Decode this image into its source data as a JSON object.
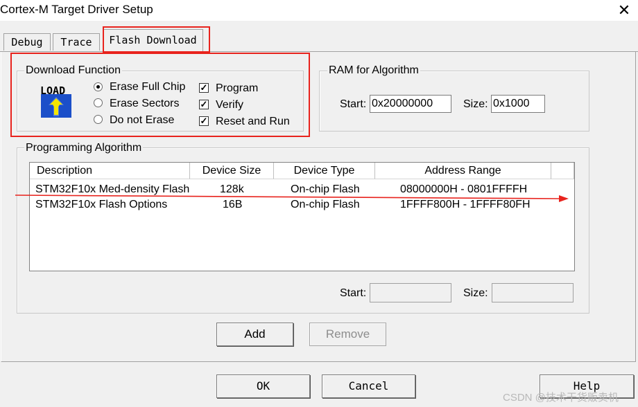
{
  "window": {
    "title": "Cortex-M Target Driver Setup",
    "close_glyph": "✕"
  },
  "tabs": [
    {
      "label": "Debug",
      "active": false
    },
    {
      "label": "Trace",
      "active": false
    },
    {
      "label": "Flash Download",
      "active": true
    }
  ],
  "download_function": {
    "legend": "Download Function",
    "logo_text": "LOAD",
    "radios": [
      {
        "label": "Erase Full Chip",
        "selected": true
      },
      {
        "label": "Erase Sectors",
        "selected": false
      },
      {
        "label": "Do not Erase",
        "selected": false
      }
    ],
    "checks": [
      {
        "label": "Program",
        "checked": true
      },
      {
        "label": "Verify",
        "checked": true
      },
      {
        "label": "Reset and Run",
        "checked": true
      }
    ],
    "check_glyph": "✓"
  },
  "ram": {
    "legend": "RAM for Algorithm",
    "start_label": "Start:",
    "start_value": "0x20000000",
    "size_label": "Size:",
    "size_value": "0x1000"
  },
  "programming": {
    "legend": "Programming Algorithm",
    "columns": [
      "Description",
      "Device Size",
      "Device Type",
      "Address Range"
    ],
    "rows": [
      [
        "STM32F10x Med-density Flash",
        "128k",
        "On-chip Flash",
        "08000000H - 0801FFFFH"
      ],
      [
        "STM32F10x Flash Options",
        "16B",
        "On-chip Flash",
        "1FFFF800H - 1FFFF80FH"
      ]
    ],
    "start_label": "Start:",
    "start_value": "",
    "size_label": "Size:",
    "size_value": "",
    "add_label": "Add",
    "remove_label": "Remove"
  },
  "footer": {
    "ok_label": "OK",
    "cancel_label": "Cancel",
    "help_label": "Help"
  },
  "watermark": "CSDN @技术干货贩卖机",
  "colors": {
    "highlight": "#e8231d",
    "arrow": "#e8231d"
  }
}
